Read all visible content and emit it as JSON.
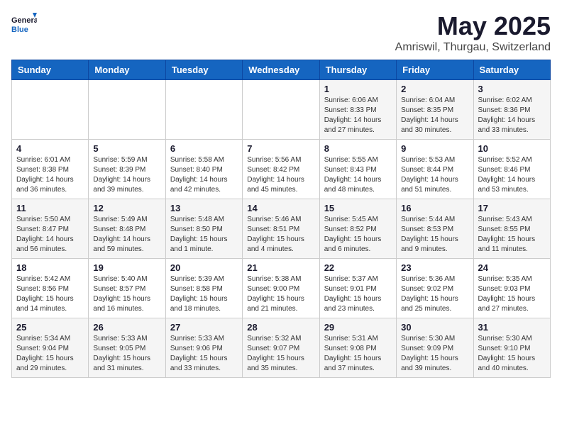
{
  "logo": {
    "general": "General",
    "blue": "Blue"
  },
  "title": "May 2025",
  "subtitle": "Amriswil, Thurgau, Switzerland",
  "weekdays": [
    "Sunday",
    "Monday",
    "Tuesday",
    "Wednesday",
    "Thursday",
    "Friday",
    "Saturday"
  ],
  "weeks": [
    [
      {
        "day": "",
        "info": ""
      },
      {
        "day": "",
        "info": ""
      },
      {
        "day": "",
        "info": ""
      },
      {
        "day": "",
        "info": ""
      },
      {
        "day": "1",
        "info": "Sunrise: 6:06 AM\nSunset: 8:33 PM\nDaylight: 14 hours\nand 27 minutes."
      },
      {
        "day": "2",
        "info": "Sunrise: 6:04 AM\nSunset: 8:35 PM\nDaylight: 14 hours\nand 30 minutes."
      },
      {
        "day": "3",
        "info": "Sunrise: 6:02 AM\nSunset: 8:36 PM\nDaylight: 14 hours\nand 33 minutes."
      }
    ],
    [
      {
        "day": "4",
        "info": "Sunrise: 6:01 AM\nSunset: 8:38 PM\nDaylight: 14 hours\nand 36 minutes."
      },
      {
        "day": "5",
        "info": "Sunrise: 5:59 AM\nSunset: 8:39 PM\nDaylight: 14 hours\nand 39 minutes."
      },
      {
        "day": "6",
        "info": "Sunrise: 5:58 AM\nSunset: 8:40 PM\nDaylight: 14 hours\nand 42 minutes."
      },
      {
        "day": "7",
        "info": "Sunrise: 5:56 AM\nSunset: 8:42 PM\nDaylight: 14 hours\nand 45 minutes."
      },
      {
        "day": "8",
        "info": "Sunrise: 5:55 AM\nSunset: 8:43 PM\nDaylight: 14 hours\nand 48 minutes."
      },
      {
        "day": "9",
        "info": "Sunrise: 5:53 AM\nSunset: 8:44 PM\nDaylight: 14 hours\nand 51 minutes."
      },
      {
        "day": "10",
        "info": "Sunrise: 5:52 AM\nSunset: 8:46 PM\nDaylight: 14 hours\nand 53 minutes."
      }
    ],
    [
      {
        "day": "11",
        "info": "Sunrise: 5:50 AM\nSunset: 8:47 PM\nDaylight: 14 hours\nand 56 minutes."
      },
      {
        "day": "12",
        "info": "Sunrise: 5:49 AM\nSunset: 8:48 PM\nDaylight: 14 hours\nand 59 minutes."
      },
      {
        "day": "13",
        "info": "Sunrise: 5:48 AM\nSunset: 8:50 PM\nDaylight: 15 hours\nand 1 minute."
      },
      {
        "day": "14",
        "info": "Sunrise: 5:46 AM\nSunset: 8:51 PM\nDaylight: 15 hours\nand 4 minutes."
      },
      {
        "day": "15",
        "info": "Sunrise: 5:45 AM\nSunset: 8:52 PM\nDaylight: 15 hours\nand 6 minutes."
      },
      {
        "day": "16",
        "info": "Sunrise: 5:44 AM\nSunset: 8:53 PM\nDaylight: 15 hours\nand 9 minutes."
      },
      {
        "day": "17",
        "info": "Sunrise: 5:43 AM\nSunset: 8:55 PM\nDaylight: 15 hours\nand 11 minutes."
      }
    ],
    [
      {
        "day": "18",
        "info": "Sunrise: 5:42 AM\nSunset: 8:56 PM\nDaylight: 15 hours\nand 14 minutes."
      },
      {
        "day": "19",
        "info": "Sunrise: 5:40 AM\nSunset: 8:57 PM\nDaylight: 15 hours\nand 16 minutes."
      },
      {
        "day": "20",
        "info": "Sunrise: 5:39 AM\nSunset: 8:58 PM\nDaylight: 15 hours\nand 18 minutes."
      },
      {
        "day": "21",
        "info": "Sunrise: 5:38 AM\nSunset: 9:00 PM\nDaylight: 15 hours\nand 21 minutes."
      },
      {
        "day": "22",
        "info": "Sunrise: 5:37 AM\nSunset: 9:01 PM\nDaylight: 15 hours\nand 23 minutes."
      },
      {
        "day": "23",
        "info": "Sunrise: 5:36 AM\nSunset: 9:02 PM\nDaylight: 15 hours\nand 25 minutes."
      },
      {
        "day": "24",
        "info": "Sunrise: 5:35 AM\nSunset: 9:03 PM\nDaylight: 15 hours\nand 27 minutes."
      }
    ],
    [
      {
        "day": "25",
        "info": "Sunrise: 5:34 AM\nSunset: 9:04 PM\nDaylight: 15 hours\nand 29 minutes."
      },
      {
        "day": "26",
        "info": "Sunrise: 5:33 AM\nSunset: 9:05 PM\nDaylight: 15 hours\nand 31 minutes."
      },
      {
        "day": "27",
        "info": "Sunrise: 5:33 AM\nSunset: 9:06 PM\nDaylight: 15 hours\nand 33 minutes."
      },
      {
        "day": "28",
        "info": "Sunrise: 5:32 AM\nSunset: 9:07 PM\nDaylight: 15 hours\nand 35 minutes."
      },
      {
        "day": "29",
        "info": "Sunrise: 5:31 AM\nSunset: 9:08 PM\nDaylight: 15 hours\nand 37 minutes."
      },
      {
        "day": "30",
        "info": "Sunrise: 5:30 AM\nSunset: 9:09 PM\nDaylight: 15 hours\nand 39 minutes."
      },
      {
        "day": "31",
        "info": "Sunrise: 5:30 AM\nSunset: 9:10 PM\nDaylight: 15 hours\nand 40 minutes."
      }
    ]
  ]
}
